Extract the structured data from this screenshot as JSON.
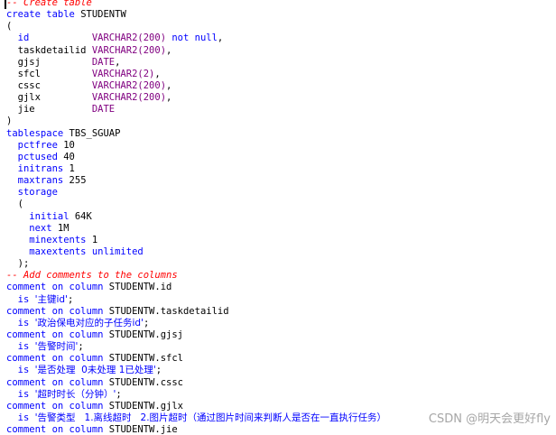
{
  "lines": [
    [
      {
        "t": "-- Create table",
        "c": "cm"
      }
    ],
    [
      {
        "t": "create table ",
        "c": "kw"
      },
      {
        "t": "STUDENTW",
        "c": "id"
      }
    ],
    [
      {
        "t": "(",
        "c": "pun"
      }
    ],
    [
      {
        "t": "  id           ",
        "c": "kw"
      },
      {
        "t": "VARCHAR2",
        "c": "ty"
      },
      {
        "t": "(200) ",
        "c": "ty"
      },
      {
        "t": "not null",
        "c": "kw"
      },
      {
        "t": ",",
        "c": "pun"
      }
    ],
    [
      {
        "t": "  taskdetailid ",
        "c": "id"
      },
      {
        "t": "VARCHAR2",
        "c": "ty"
      },
      {
        "t": "(200)",
        "c": "ty"
      },
      {
        "t": ",",
        "c": "pun"
      }
    ],
    [
      {
        "t": "  gjsj         ",
        "c": "id"
      },
      {
        "t": "DATE",
        "c": "ty"
      },
      {
        "t": ",",
        "c": "pun"
      }
    ],
    [
      {
        "t": "  sfcl         ",
        "c": "id"
      },
      {
        "t": "VARCHAR2",
        "c": "ty"
      },
      {
        "t": "(2)",
        "c": "ty"
      },
      {
        "t": ",",
        "c": "pun"
      }
    ],
    [
      {
        "t": "  cssc         ",
        "c": "id"
      },
      {
        "t": "VARCHAR2",
        "c": "ty"
      },
      {
        "t": "(200)",
        "c": "ty"
      },
      {
        "t": ",",
        "c": "pun"
      }
    ],
    [
      {
        "t": "  gjlx         ",
        "c": "id"
      },
      {
        "t": "VARCHAR2",
        "c": "ty"
      },
      {
        "t": "(200)",
        "c": "ty"
      },
      {
        "t": ",",
        "c": "pun"
      }
    ],
    [
      {
        "t": "  jie          ",
        "c": "id"
      },
      {
        "t": "DATE",
        "c": "ty"
      }
    ],
    [
      {
        "t": ")",
        "c": "pun"
      }
    ],
    [
      {
        "t": "tablespace ",
        "c": "kw"
      },
      {
        "t": "TBS_SGUAP",
        "c": "id"
      }
    ],
    [
      {
        "t": "  pctfree ",
        "c": "kw"
      },
      {
        "t": "10",
        "c": "num"
      }
    ],
    [
      {
        "t": "  pctused ",
        "c": "kw"
      },
      {
        "t": "40",
        "c": "num"
      }
    ],
    [
      {
        "t": "  initrans ",
        "c": "kw"
      },
      {
        "t": "1",
        "c": "num"
      }
    ],
    [
      {
        "t": "  maxtrans ",
        "c": "kw"
      },
      {
        "t": "255",
        "c": "num"
      }
    ],
    [
      {
        "t": "  storage",
        "c": "kw"
      }
    ],
    [
      {
        "t": "  (",
        "c": "pun"
      }
    ],
    [
      {
        "t": "    initial ",
        "c": "kw"
      },
      {
        "t": "64K",
        "c": "num"
      }
    ],
    [
      {
        "t": "    next ",
        "c": "kw"
      },
      {
        "t": "1M",
        "c": "num"
      }
    ],
    [
      {
        "t": "    minextents ",
        "c": "kw"
      },
      {
        "t": "1",
        "c": "num"
      }
    ],
    [
      {
        "t": "    maxextents unlimited",
        "c": "kw"
      }
    ],
    [
      {
        "t": "  );",
        "c": "pun"
      }
    ],
    [
      {
        "t": "-- Add comments to the columns",
        "c": "cm"
      }
    ],
    [
      {
        "t": "comment on column ",
        "c": "kw"
      },
      {
        "t": "STUDENTW.id",
        "c": "id"
      }
    ],
    [
      {
        "t": "  is ",
        "c": "kw"
      },
      {
        "t": "'主键id'",
        "c": "str",
        "cjk": true
      },
      {
        "t": ";",
        "c": "pun"
      }
    ],
    [
      {
        "t": "comment on column ",
        "c": "kw"
      },
      {
        "t": "STUDENTW.taskdetailid",
        "c": "id"
      }
    ],
    [
      {
        "t": "  is ",
        "c": "kw"
      },
      {
        "t": "'政治保电对应的子任务id'",
        "c": "str",
        "cjk": true
      },
      {
        "t": ";",
        "c": "pun"
      }
    ],
    [
      {
        "t": "comment on column ",
        "c": "kw"
      },
      {
        "t": "STUDENTW.gjsj",
        "c": "id"
      }
    ],
    [
      {
        "t": "  is ",
        "c": "kw"
      },
      {
        "t": "'告警时间'",
        "c": "str",
        "cjk": true
      },
      {
        "t": ";",
        "c": "pun"
      }
    ],
    [
      {
        "t": "comment on column ",
        "c": "kw"
      },
      {
        "t": "STUDENTW.sfcl",
        "c": "id"
      }
    ],
    [
      {
        "t": "  is ",
        "c": "kw"
      },
      {
        "t": "'是否处理  0未处理 1已处理'",
        "c": "str",
        "cjk": true
      },
      {
        "t": ";",
        "c": "pun"
      }
    ],
    [
      {
        "t": "comment on column ",
        "c": "kw"
      },
      {
        "t": "STUDENTW.cssc",
        "c": "id"
      }
    ],
    [
      {
        "t": "  is ",
        "c": "kw"
      },
      {
        "t": "'超时时长（分钟）'",
        "c": "str",
        "cjk": true
      },
      {
        "t": ";",
        "c": "pun"
      }
    ],
    [
      {
        "t": "comment on column ",
        "c": "kw"
      },
      {
        "t": "STUDENTW.gjlx",
        "c": "id"
      }
    ],
    [
      {
        "t": "  is ",
        "c": "kw"
      },
      {
        "t": "'告警类型   1.离线超时   2.图片超时（通过图片时间来判断人是否在一直执行任务）",
        "c": "str",
        "cjk": true
      }
    ],
    [
      {
        "t": "comment on column ",
        "c": "kw"
      },
      {
        "t": "STUDENTW.jie",
        "c": "id"
      }
    ]
  ],
  "watermark": "CSDN @明天会更好fly"
}
